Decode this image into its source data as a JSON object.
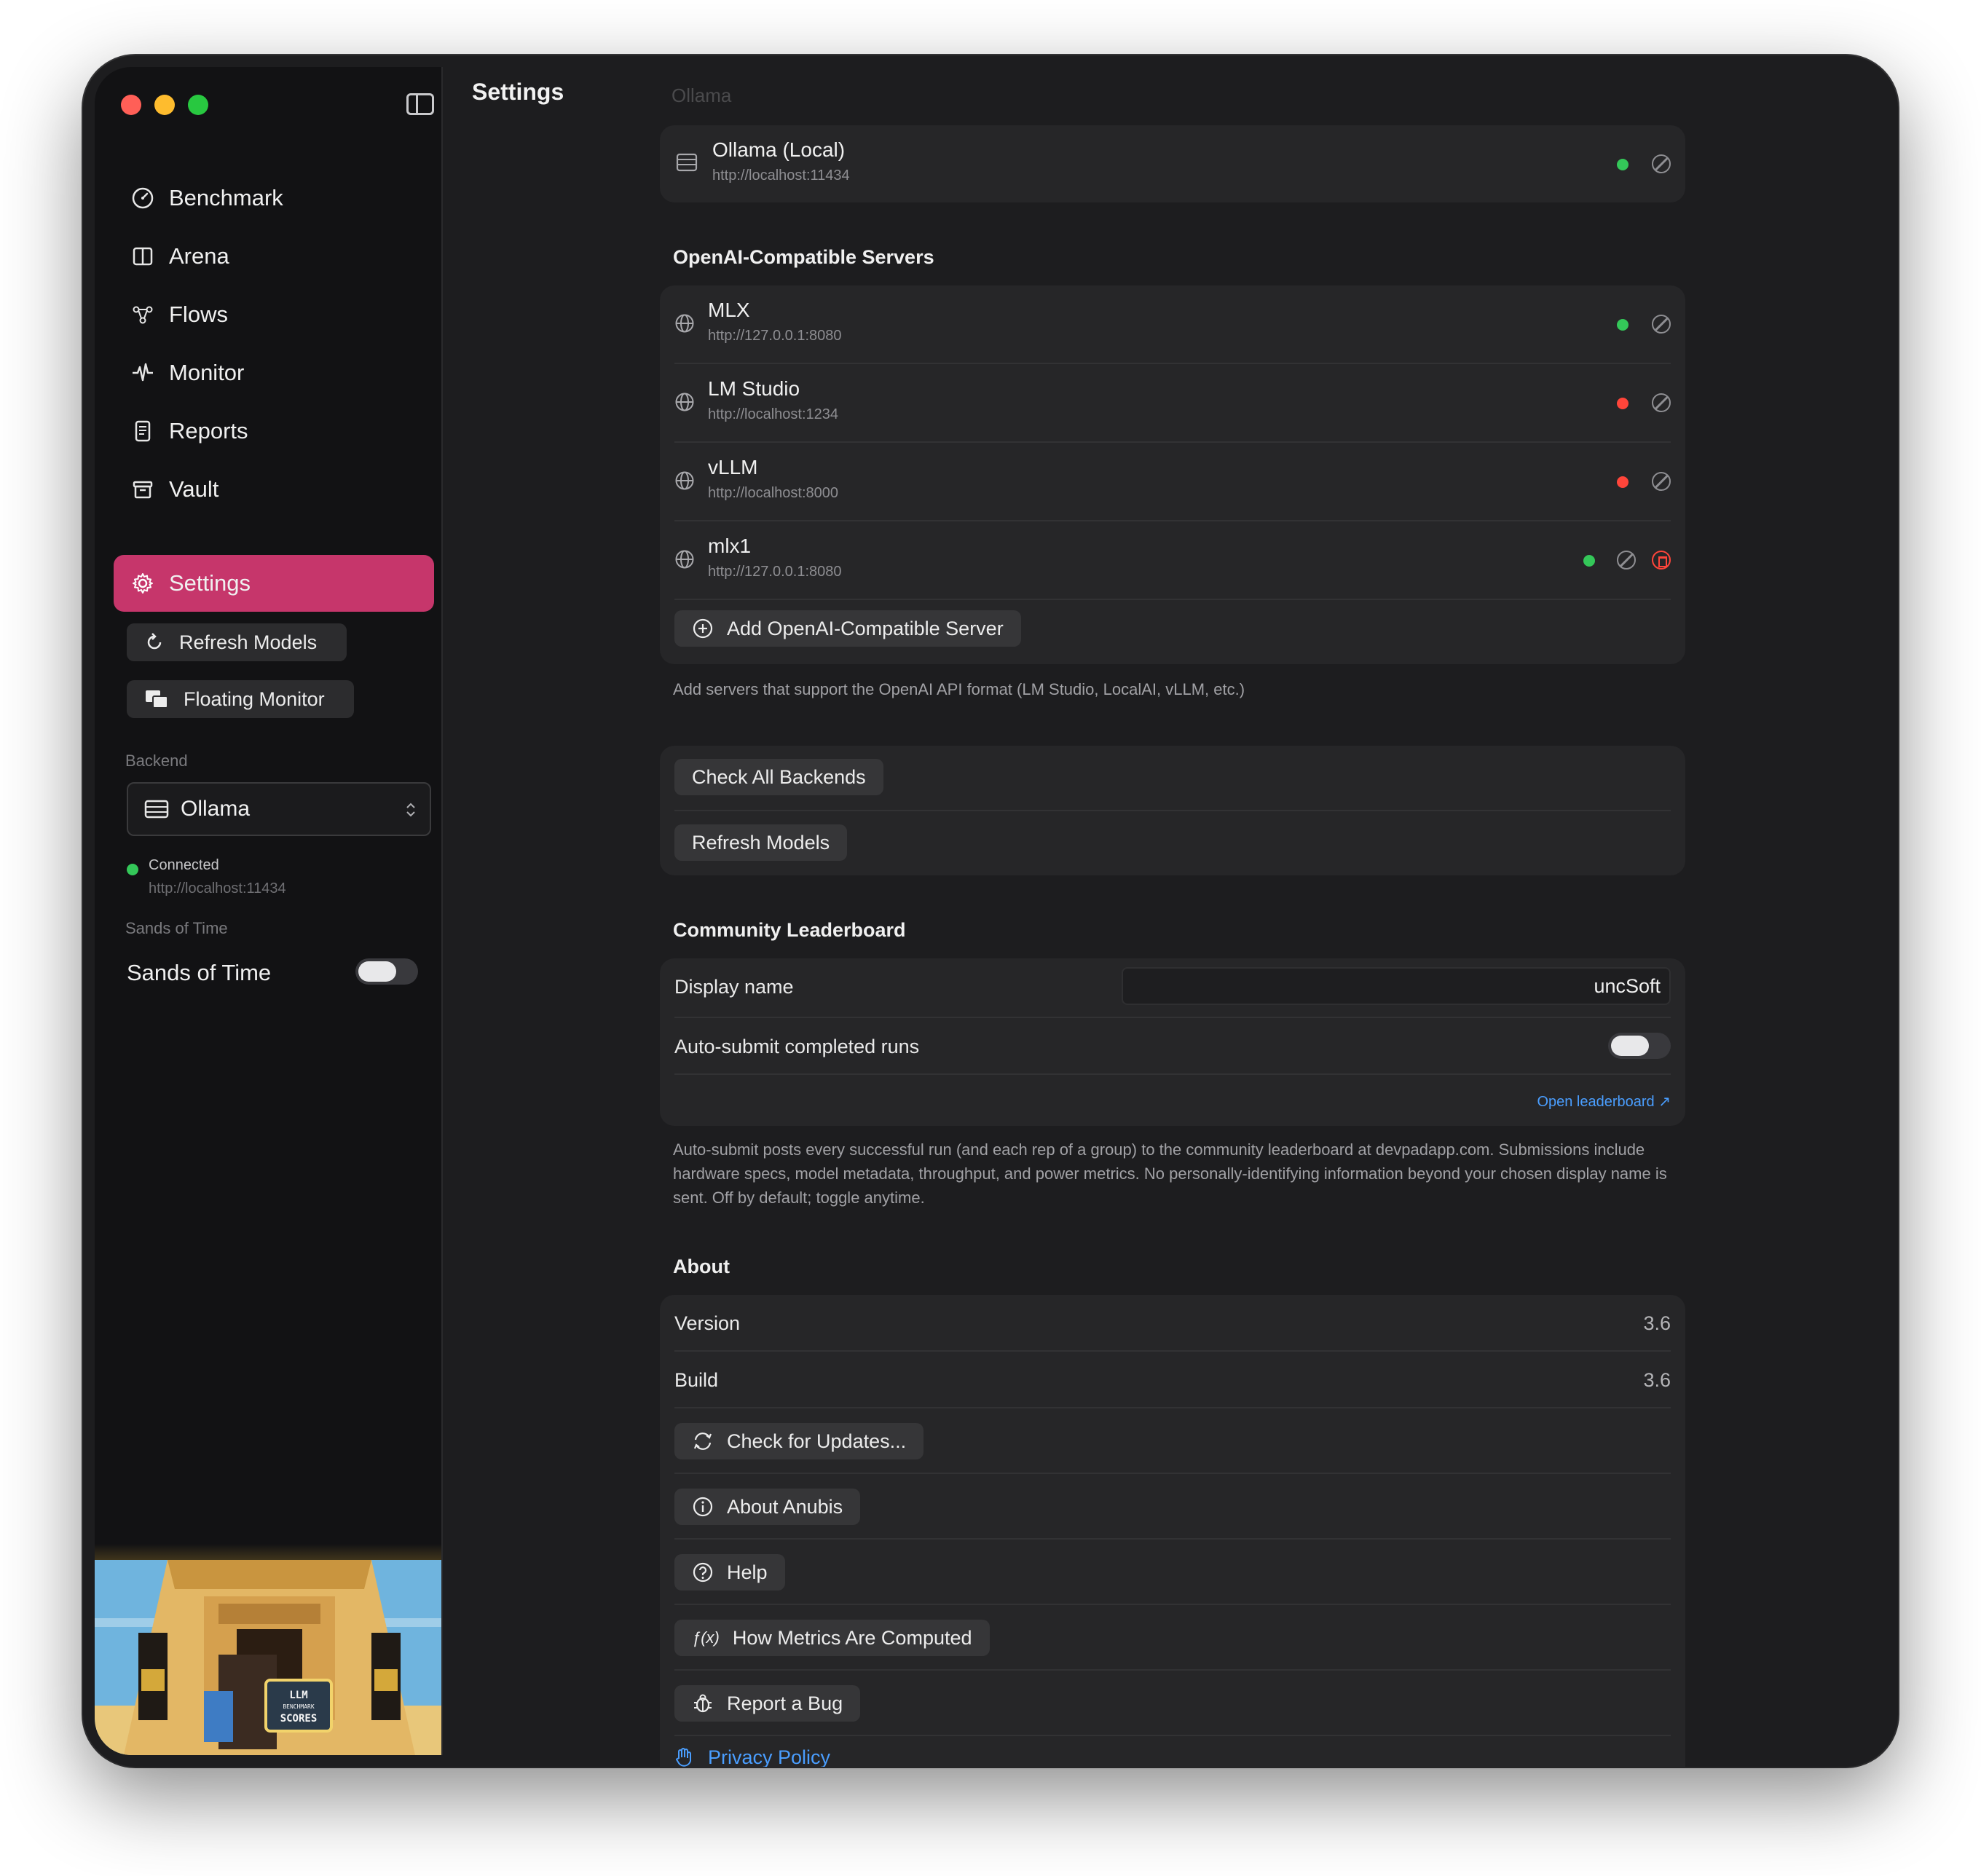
{
  "sidebar": {
    "nav": [
      {
        "label": "Benchmark",
        "icon": "gauge-icon"
      },
      {
        "label": "Arena",
        "icon": "columns-icon"
      },
      {
        "label": "Flows",
        "icon": "flow-nodes-icon"
      },
      {
        "label": "Monitor",
        "icon": "waveform-icon"
      },
      {
        "label": "Reports",
        "icon": "document-icon"
      },
      {
        "label": "Vault",
        "icon": "archive-box-icon"
      }
    ],
    "active": {
      "label": "Settings",
      "icon": "gear-icon"
    },
    "refresh_models": "Refresh Models",
    "floating_monitor": "Floating Monitor",
    "backend_label": "Backend",
    "backend_value": "Ollama",
    "status": "Connected",
    "status_url": "http://localhost:11434",
    "sands_section": "Sands of Time",
    "sands_label": "Sands of Time",
    "art_text": [
      "LLM",
      "BENCHMARK",
      "SCORES"
    ]
  },
  "main": {
    "title": "Settings",
    "faded_header": "Ollama",
    "ollama_server": {
      "name": "Ollama (Local)",
      "url": "http://localhost:11434",
      "status": "green"
    },
    "openai_header": "OpenAI-Compatible Servers",
    "servers": [
      {
        "name": "MLX",
        "url": "http://127.0.0.1:8080",
        "status": "green"
      },
      {
        "name": "LM Studio",
        "url": "http://localhost:1234",
        "status": "red"
      },
      {
        "name": "vLLM",
        "url": "http://localhost:8000",
        "status": "red"
      },
      {
        "name": "mlx1",
        "url": "http://127.0.0.1:8080",
        "status": "green"
      }
    ],
    "add_server": "Add OpenAI-Compatible Server",
    "add_server_help": "Add servers that support the OpenAI API format (LM Studio, LocalAI, vLLM, etc.)",
    "check_all": "Check All Backends",
    "refresh_models": "Refresh Models",
    "leaderboard_header": "Community Leaderboard",
    "display_name_label": "Display name",
    "display_name_value": "uncSoft",
    "auto_submit_label": "Auto-submit completed runs",
    "open_leaderboard": "Open leaderboard ↗",
    "leaderboard_help": "Auto-submit posts every successful run (and each rep of a group) to the community leaderboard at devpadapp.com. Submissions include hardware specs, model metadata, throughput, and power metrics. No personally-identifying information beyond your chosen display name is sent. Off by default; toggle anytime.",
    "about_header": "About",
    "version_label": "Version",
    "version_value": "3.6",
    "build_label": "Build",
    "build_value": "3.6",
    "check_updates": "Check for Updates...",
    "about_anubis": "About Anubis",
    "help": "Help",
    "how_metrics": "How Metrics Are Computed",
    "fx_glyph": "ƒ(x)",
    "report_bug": "Report a Bug",
    "privacy": "Privacy Policy"
  },
  "colors": {
    "accent": "#c6366b",
    "green": "#34c759",
    "red": "#ff453a",
    "link": "#4a9eff"
  }
}
